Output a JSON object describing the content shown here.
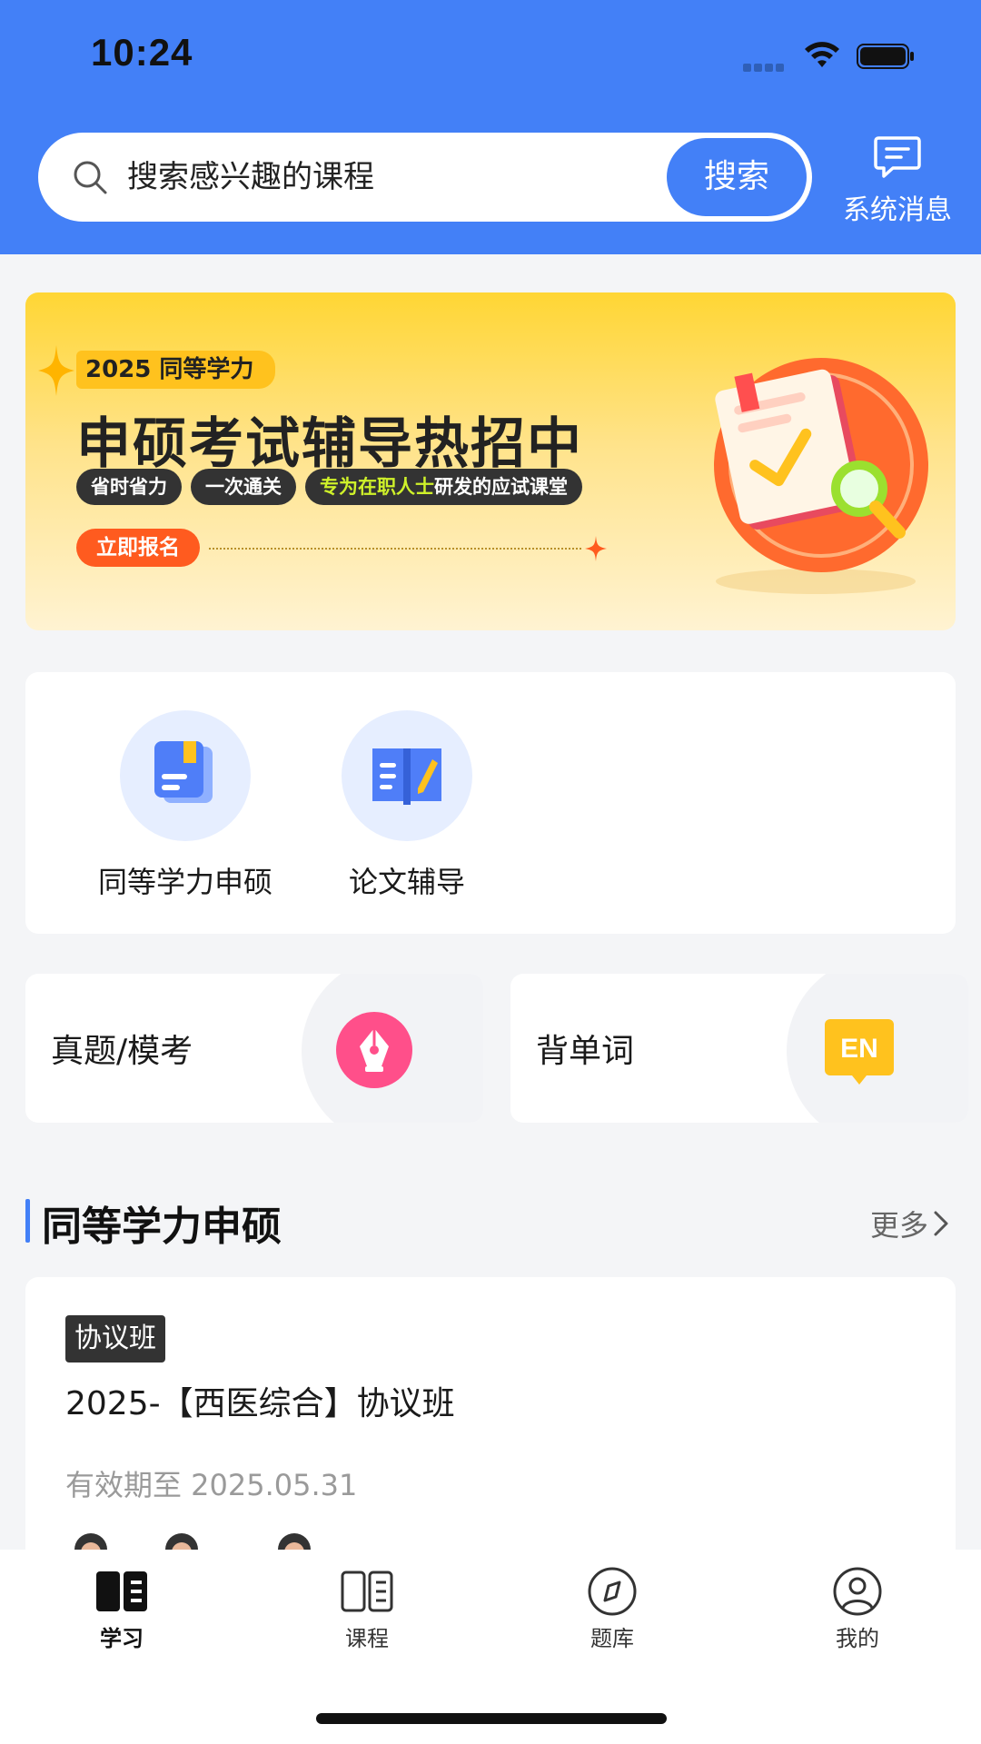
{
  "status_bar": {
    "time": "10:24"
  },
  "header": {
    "search_placeholder": "搜索感兴趣的课程",
    "search_button": "搜索",
    "messages_label": "系统消息",
    "bg_color": "#4380f7"
  },
  "banner": {
    "tag": "2025 同等学力",
    "title": "申硕考试辅导热招中",
    "chips": [
      "省时省力",
      "一次通关"
    ],
    "chip3_highlight": "专为在职人士",
    "chip3_rest": "研发的应试课堂",
    "cta": "立即报名"
  },
  "categories": [
    {
      "label": "同等学力申硕",
      "icon": "book-stack-icon"
    },
    {
      "label": "论文辅导",
      "icon": "notebook-pen-icon"
    }
  ],
  "tools": [
    {
      "label": "真题/模考",
      "icon": "fountain-pen-icon"
    },
    {
      "label": "背单词",
      "icon": "en-badge-icon",
      "icon_text": "EN"
    }
  ],
  "section": {
    "title": "同等学力申硕",
    "more": "更多"
  },
  "course": {
    "badge": "协议班",
    "title": "2025-【西医综合】协议班",
    "validity": "有效期至 2025.05.31"
  },
  "tabbar": {
    "items": [
      {
        "label": "学习",
        "icon": "book-open-filled-icon",
        "active": true
      },
      {
        "label": "课程",
        "icon": "book-open-outline-icon",
        "active": false
      },
      {
        "label": "题库",
        "icon": "compass-icon",
        "active": false
      },
      {
        "label": "我的",
        "icon": "user-profile-icon",
        "active": false
      }
    ]
  }
}
